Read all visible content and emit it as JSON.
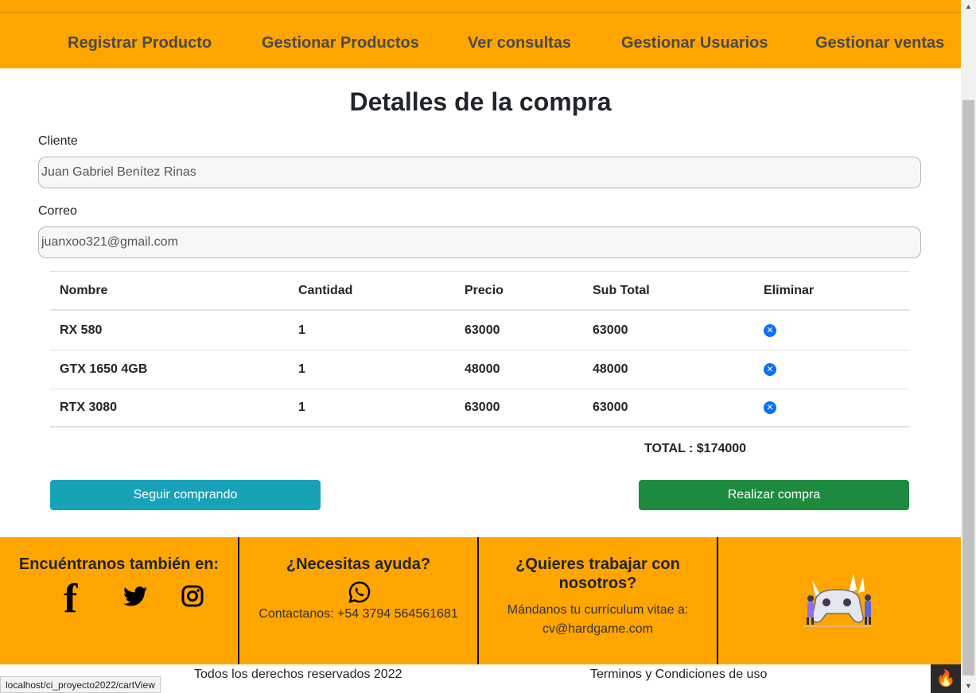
{
  "nav": {
    "items": [
      "Registrar Producto",
      "Gestionar Productos",
      "Ver consultas",
      "Gestionar Usuarios",
      "Gestionar ventas"
    ]
  },
  "main": {
    "title": "Detalles de la compra",
    "client_label": "Cliente",
    "client_value": "Juan Gabriel Benítez Rinas",
    "email_label": "Correo",
    "email_value": "juanxoo321@gmail.com"
  },
  "cart": {
    "headers": [
      "Nombre",
      "Cantidad",
      "Precio",
      "Sub Total",
      "Eliminar"
    ],
    "rows": [
      {
        "name": "RX 580",
        "qty": "1",
        "price": "63000",
        "subtotal": "63000"
      },
      {
        "name": "GTX 1650 4GB",
        "qty": "1",
        "price": "48000",
        "subtotal": "48000"
      },
      {
        "name": "RTX 3080",
        "qty": "1",
        "price": "63000",
        "subtotal": "63000"
      }
    ],
    "total": "TOTAL : $174000",
    "continue_label": "Seguir comprando",
    "checkout_label": "Realizar compra"
  },
  "footer": {
    "find_us": "Encuéntranos también en:",
    "help_title": "¿Necesitas ayuda?",
    "help_contact": "Contactanos: +54 3794 564561681",
    "work_title": "¿Quieres trabajar con nosotros?",
    "work_text": "Mándanos tu currículum vitae a:",
    "work_email": "cv@hardgame.com",
    "rights": "Todos los derechos reservados 2022",
    "terms": "Terminos y Condiciones de uso"
  },
  "status_url": "localhost/ci_proyecto2022/cartView",
  "colors": {
    "nav_bg": "#ffa500",
    "info_button": "#17a2b8",
    "success_button": "#1e8a3e",
    "delete_icon": "#0d6efd"
  },
  "icons": [
    "facebook-icon",
    "twitter-icon",
    "instagram-icon",
    "whatsapp-icon",
    "delete-icon",
    "flame-icon"
  ]
}
